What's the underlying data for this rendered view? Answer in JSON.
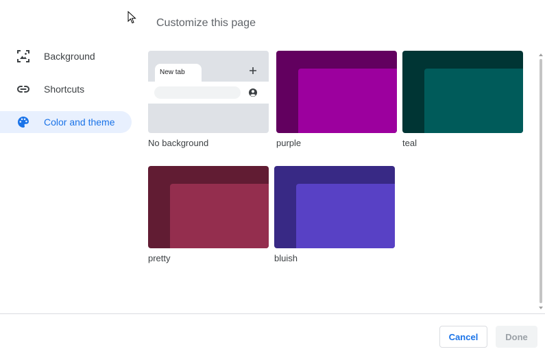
{
  "dialog": {
    "title": "Customize this page"
  },
  "sidebar": {
    "items": [
      {
        "label": "Background",
        "icon": "background-icon",
        "active": false
      },
      {
        "label": "Shortcuts",
        "icon": "link-icon",
        "active": false
      },
      {
        "label": "Color and theme",
        "icon": "palette-icon",
        "active": true
      }
    ]
  },
  "themes": [
    {
      "name": "No background",
      "outer": "#dee1e6",
      "inner": ""
    },
    {
      "name": "purple",
      "outer": "#62005f",
      "inner": "#9c009e"
    },
    {
      "name": "teal",
      "outer": "#003534",
      "inner": "#005b5a"
    },
    {
      "name": "pretty",
      "outer": "#611c33",
      "inner": "#942e4e"
    },
    {
      "name": "bluish",
      "outer": "#382985",
      "inner": "#5841c5"
    }
  ],
  "preview": {
    "tab_label": "New tab"
  },
  "footer": {
    "cancel_label": "Cancel",
    "done_label": "Done"
  },
  "colors": {
    "accent": "#1a73e8",
    "active_bg": "#e8f0fe"
  }
}
